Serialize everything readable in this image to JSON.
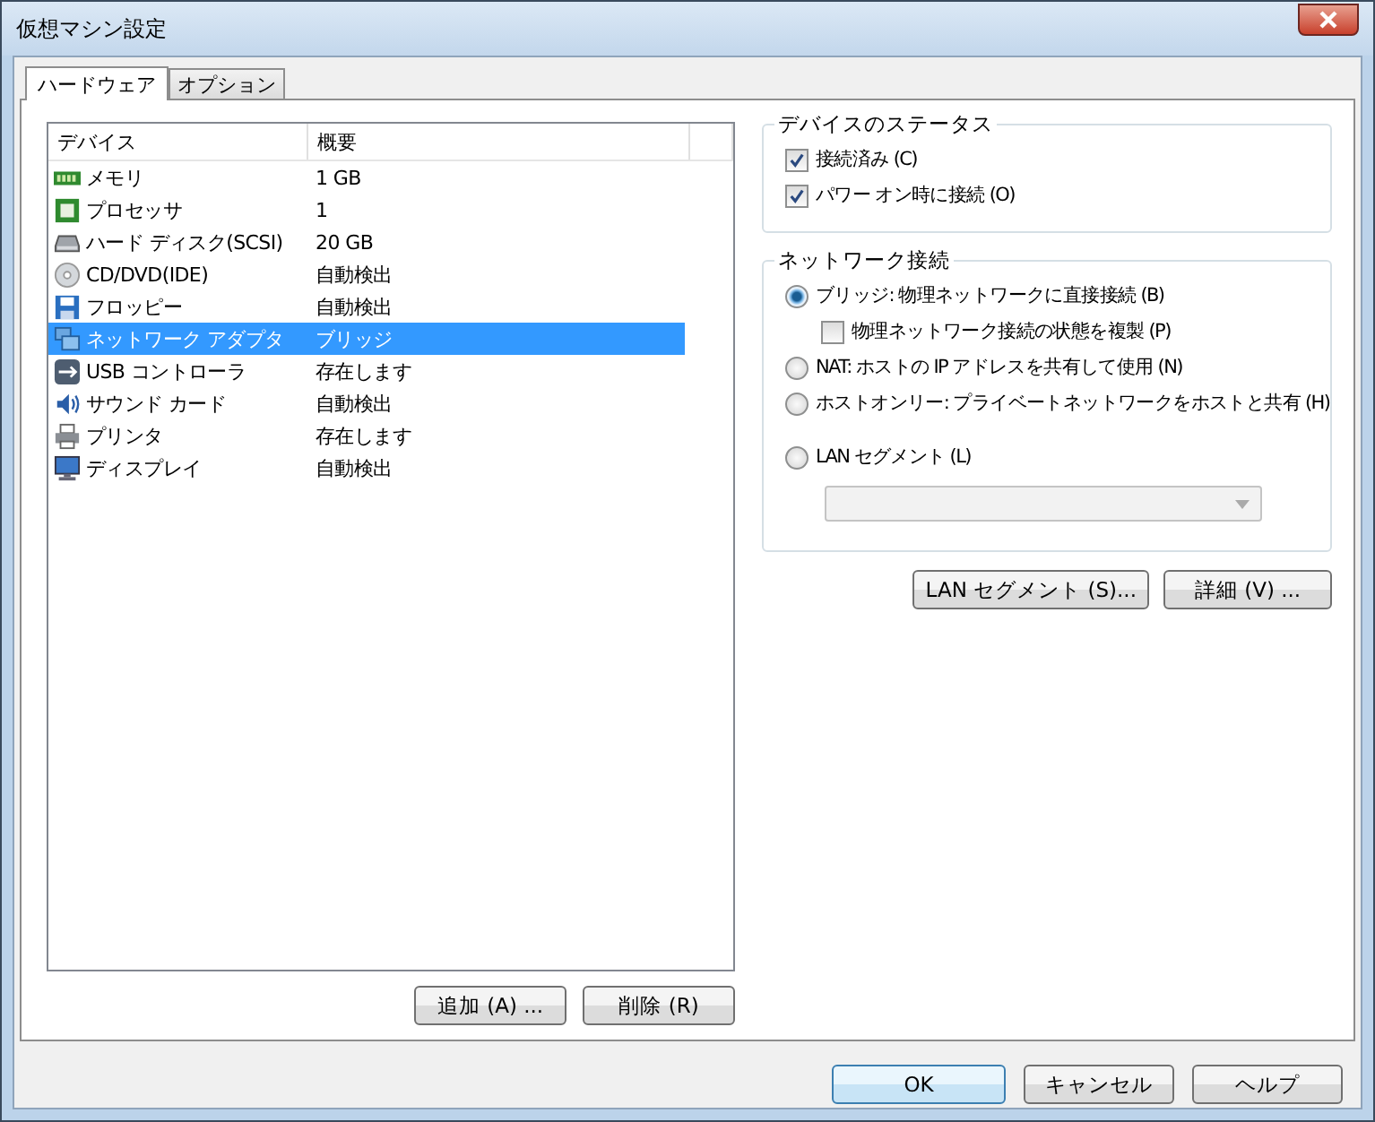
{
  "window": {
    "title": "仮想マシン設定"
  },
  "tabs": [
    {
      "label": "ハードウェア",
      "selected": true
    },
    {
      "label": "オプション",
      "selected": false
    }
  ],
  "device_table": {
    "columns": [
      "デバイス",
      "概要"
    ],
    "rows": [
      {
        "kind": "memory",
        "device": "メモリ",
        "summary": "1 GB",
        "selected": false
      },
      {
        "kind": "processor",
        "device": "プロセッサ",
        "summary": "1",
        "selected": false
      },
      {
        "kind": "disk",
        "device": "ハード ディスク(SCSI)",
        "summary": "20 GB",
        "selected": false
      },
      {
        "kind": "cd",
        "device": "CD/DVD(IDE)",
        "summary": "自動検出",
        "selected": false
      },
      {
        "kind": "floppy",
        "device": "フロッピー",
        "summary": "自動検出",
        "selected": false
      },
      {
        "kind": "network",
        "device": "ネットワーク アダプタ",
        "summary": "ブリッジ",
        "selected": true
      },
      {
        "kind": "usb",
        "device": "USB コントローラ",
        "summary": "存在します",
        "selected": false
      },
      {
        "kind": "sound",
        "device": "サウンド カード",
        "summary": "自動検出",
        "selected": false
      },
      {
        "kind": "printer",
        "device": "プリンタ",
        "summary": "存在します",
        "selected": false
      },
      {
        "kind": "display",
        "device": "ディスプレイ",
        "summary": "自動検出",
        "selected": false
      }
    ]
  },
  "list_buttons": [
    "追加 (A) ...",
    "削除 (R)"
  ],
  "device_status": {
    "title": "デバイスのステータス",
    "options": [
      {
        "label": "接続済み (C)",
        "checked": true
      },
      {
        "label": "パワー オン時に接続 (O)",
        "checked": true
      }
    ]
  },
  "network": {
    "title": "ネットワーク接続",
    "options": [
      {
        "kind": "radio",
        "label": "ブリッジ: 物理ネットワークに直接接続 (B)",
        "selected": true
      },
      {
        "kind": "checkbox",
        "label": "物理ネットワーク接続の状態を複製 (P)",
        "checked": false
      },
      {
        "kind": "radio",
        "label": "NAT: ホストの IP アドレスを共有して使用 (N)",
        "selected": false
      },
      {
        "kind": "radio",
        "label": "ホストオンリー: プライベートネットワークをホストと共有 (H)",
        "selected": false
      },
      {
        "kind": "radio",
        "label": "LAN セグメント (L)",
        "selected": false
      }
    ]
  },
  "network_buttons": [
    "LAN セグメント (S)...",
    "詳細 (V) ..."
  ],
  "dialog_buttons": [
    {
      "label": "OK",
      "default": true
    },
    {
      "label": "キャンセル",
      "default": false
    },
    {
      "label": "ヘルプ",
      "default": false
    }
  ]
}
